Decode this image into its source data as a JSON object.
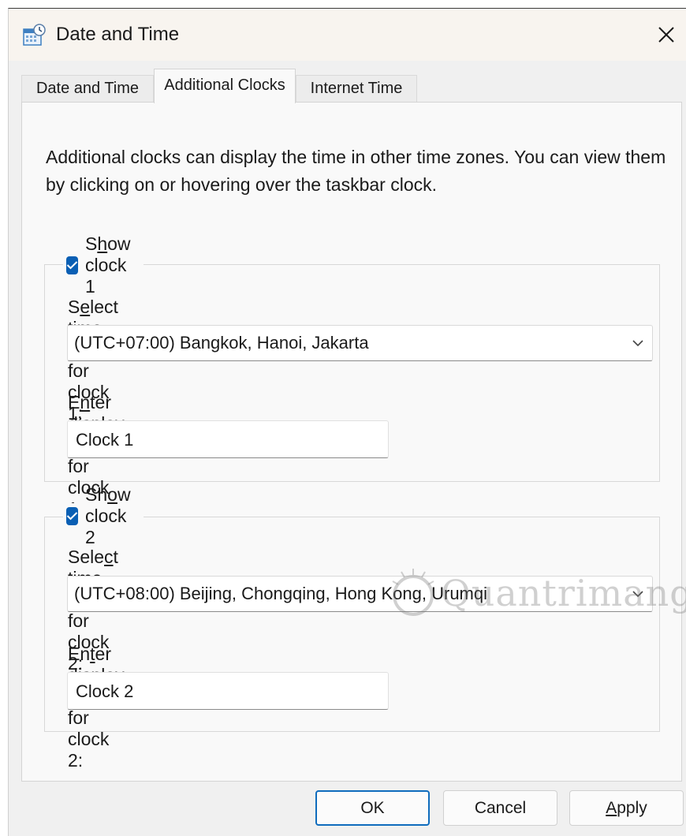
{
  "window": {
    "title": "Date and Time"
  },
  "tabs": [
    {
      "label": "Date and Time",
      "active": false
    },
    {
      "label": "Additional Clocks",
      "active": true
    },
    {
      "label": "Internet Time",
      "active": false
    }
  ],
  "intro_text": "Additional clocks can display the time in other time zones. You can view them by clicking on or hovering over the taskbar clock.",
  "clocks": [
    {
      "checked": true,
      "show_label": {
        "before": "S",
        "key": "h",
        "after": "ow clock 1"
      },
      "tz_label": {
        "before": "S",
        "key": "e",
        "after": "lect time zone for clock 1:"
      },
      "timezone": "(UTC+07:00) Bangkok, Hanoi, Jakarta",
      "name_label": {
        "before": "E",
        "key": "n",
        "after": "ter display name for clock 1:"
      },
      "display_name": "Clock 1"
    },
    {
      "checked": true,
      "show_label": {
        "before": "Sh",
        "key": "o",
        "after": "w clock 2"
      },
      "tz_label": {
        "before": "Sele",
        "key": "c",
        "after": "t time zone for clock 2:"
      },
      "timezone": "(UTC+08:00) Beijing, Chongqing, Hong Kong, Urumqi",
      "name_label": {
        "before": "En",
        "key": "t",
        "after": "er display name for clock 2:"
      },
      "display_name": "Clock 2"
    }
  ],
  "buttons": {
    "ok": "OK",
    "cancel": "Cancel",
    "apply": {
      "before": "",
      "key": "A",
      "after": "pply"
    }
  },
  "watermark": "Quantrimang",
  "colors": {
    "accent": "#0f6cbd",
    "checkbox": "#0a5fb4",
    "titlebar": "#f8f4ef"
  },
  "icons": {
    "app": "calendar-clock-icon",
    "close": "close-icon",
    "dropdown": "chevron-down-icon",
    "check": "checkmark-icon"
  }
}
